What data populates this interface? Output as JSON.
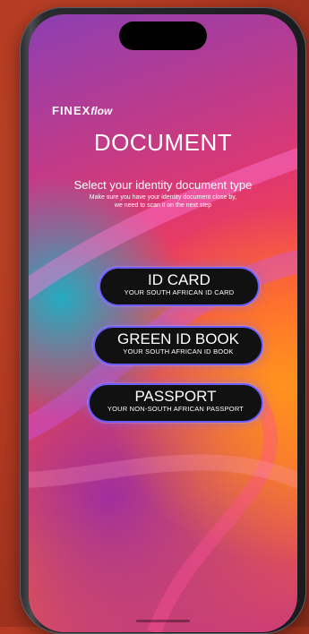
{
  "brand": {
    "name": "FINEX",
    "suffix": "flow"
  },
  "page": {
    "title": "DOCUMENT",
    "subtitle": "Select your identity document type",
    "hint_line1": "Make sure you have your identity document close by,",
    "hint_line2": "we need to scan it on the next step"
  },
  "options": [
    {
      "label": "ID CARD",
      "caption": "YOUR SOUTH AFRICAN ID CARD"
    },
    {
      "label": "GREEN ID BOOK",
      "caption": "YOUR SOUTH AFRICAN ID BOOK"
    },
    {
      "label": "PASSPORT",
      "caption": "YOUR NON-SOUTH AFRICAN PASSPORT"
    }
  ],
  "colors": {
    "button_bg": "#111111",
    "button_border": "#6a5cff",
    "text": "#ffffff"
  }
}
